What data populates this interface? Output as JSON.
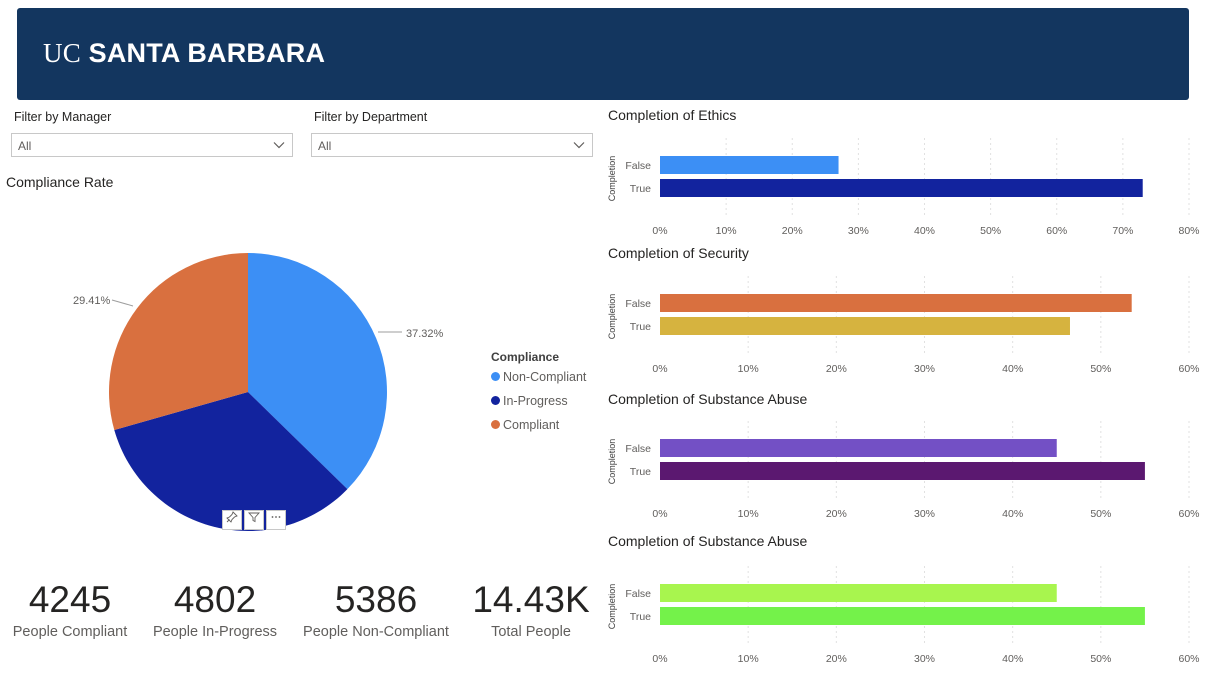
{
  "header": {
    "logo_uc": "UC",
    "logo_name": "SANTA BARBARA",
    "background": "#13365f"
  },
  "filters": [
    {
      "label": "Filter by Manager",
      "value": "All"
    },
    {
      "label": "Filter by Department",
      "value": "All"
    }
  ],
  "compliance_chart": {
    "title": "Compliance Rate",
    "legend_title": "Compliance",
    "legend": [
      {
        "name": "Non-Compliant",
        "color": "#3c8ff5"
      },
      {
        "name": "In-Progress",
        "color": "#12239e"
      },
      {
        "name": "Compliant",
        "color": "#d9703f"
      }
    ],
    "labels": {
      "non_compliant": "37.32%",
      "compliant": "29.41%"
    }
  },
  "kpis": [
    {
      "value": "4245",
      "label": "People Compliant"
    },
    {
      "value": "4802",
      "label": "People In-Progress"
    },
    {
      "value": "5386",
      "label": "People Non-Compliant"
    },
    {
      "value": "14.43K",
      "label": "Total People"
    }
  ],
  "bar_titles": {
    "ethics": "Completion of Ethics",
    "security": "Completion of Security",
    "substance1": "Completion of Substance Abuse",
    "substance2": "Completion of Substance Abuse"
  },
  "chart_data": [
    {
      "type": "pie",
      "title": "Compliance Rate",
      "categories": [
        "Non-Compliant",
        "In-Progress",
        "Compliant"
      ],
      "values": [
        37.32,
        33.27,
        29.41
      ],
      "colors": [
        "#3c8ff5",
        "#12239e",
        "#d9703f"
      ],
      "legend_title": "Compliance",
      "legend_position": "right"
    },
    {
      "type": "bar",
      "title": "Completion of Ethics",
      "ylabel": "Completion",
      "categories": [
        "False",
        "True"
      ],
      "values": [
        27,
        73
      ],
      "colors": [
        "#3c8ff5",
        "#12239e"
      ],
      "xlim": [
        0,
        80
      ],
      "ticks": [
        "0%",
        "10%",
        "20%",
        "30%",
        "40%",
        "50%",
        "60%",
        "70%",
        "80%"
      ]
    },
    {
      "type": "bar",
      "title": "Completion of Security",
      "ylabel": "Completion",
      "categories": [
        "False",
        "True"
      ],
      "values": [
        53.5,
        46.5
      ],
      "colors": [
        "#d9703f",
        "#d6b33f"
      ],
      "xlim": [
        0,
        60
      ],
      "ticks": [
        "0%",
        "10%",
        "20%",
        "30%",
        "40%",
        "50%",
        "60%"
      ]
    },
    {
      "type": "bar",
      "title": "Completion of Substance Abuse",
      "ylabel": "Completion",
      "categories": [
        "False",
        "True"
      ],
      "values": [
        45,
        55
      ],
      "colors": [
        "#7350c5",
        "#5b1870"
      ],
      "xlim": [
        0,
        60
      ],
      "ticks": [
        "0%",
        "10%",
        "20%",
        "30%",
        "40%",
        "50%",
        "60%"
      ]
    },
    {
      "type": "bar",
      "title": "Completion of Substance Abuse",
      "ylabel": "Completion",
      "categories": [
        "False",
        "True"
      ],
      "values": [
        45,
        55
      ],
      "colors": [
        "#a8f54e",
        "#74f24a"
      ],
      "xlim": [
        0,
        60
      ],
      "ticks": [
        "0%",
        "10%",
        "20%",
        "30%",
        "40%",
        "50%",
        "60%"
      ]
    }
  ]
}
